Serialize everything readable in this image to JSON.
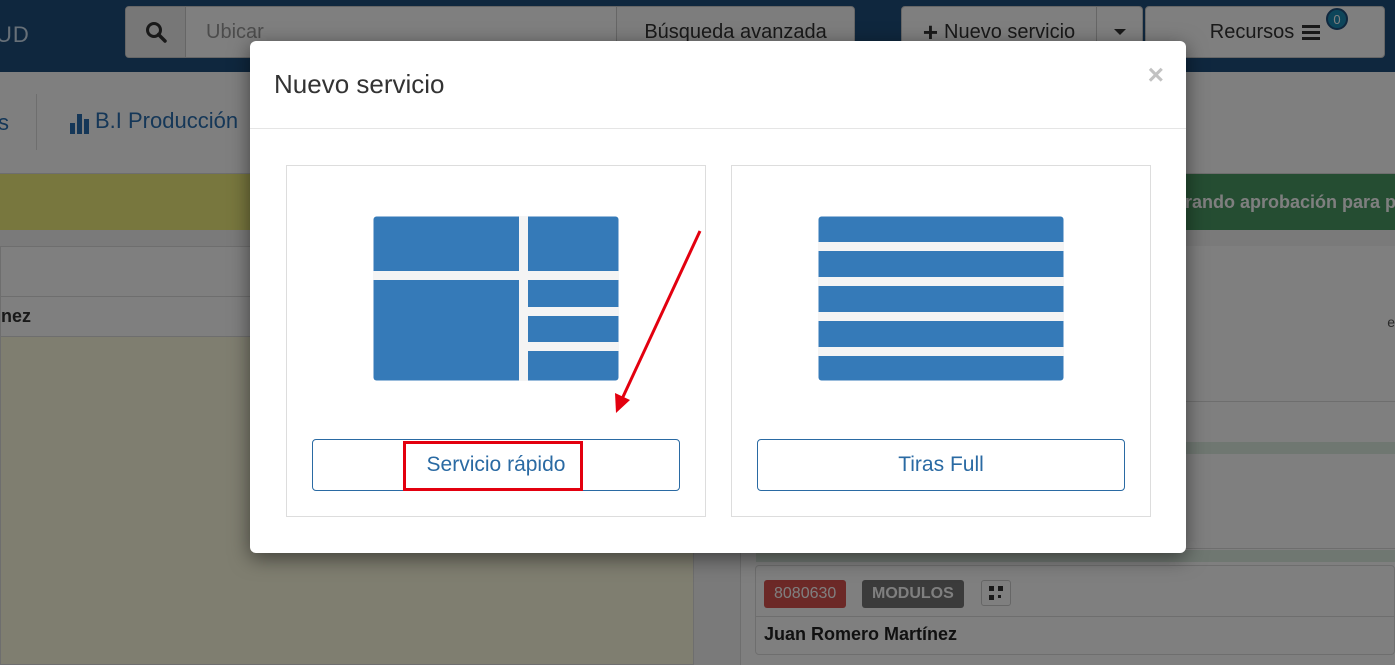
{
  "app": {
    "brand_text": "UD"
  },
  "topbar": {
    "search_placeholder": "Ubicar",
    "advanced_search_label": "Búsqueda avanzada",
    "new_service_label": "Nuevo servicio",
    "resources_label": "Recursos",
    "resources_badge": "0"
  },
  "subnav": {
    "partial_item": "s",
    "bi_link_label": "B.I Producción"
  },
  "background": {
    "status_banner_partial": "rando aprobación para p",
    "left_name_partial": "nez",
    "right_partial_char": "e",
    "card": {
      "code_label": "8080630",
      "type_label": "MODULOS",
      "customer_name": "Juan Romero Martínez"
    }
  },
  "modal": {
    "title": "Nuevo servicio",
    "close_symbol": "×",
    "options": [
      {
        "id": "quick",
        "button_label": "Servicio rápido",
        "icon": "split-layout-icon",
        "highlighted": true
      },
      {
        "id": "full",
        "button_label": "Tiras Full",
        "icon": "strips-layout-icon",
        "highlighted": false
      }
    ]
  },
  "colors": {
    "topbar": "#1f4f7c",
    "thumbnail_blue": "#357ab8",
    "button_border": "#2a6aa3",
    "annotation_red": "#e3000f",
    "badge": "#1a8bb5",
    "label_red": "#d9534f",
    "label_gray": "#777777",
    "banner_green": "#4a9a64",
    "banner_yellow": "#f0ee7d"
  }
}
